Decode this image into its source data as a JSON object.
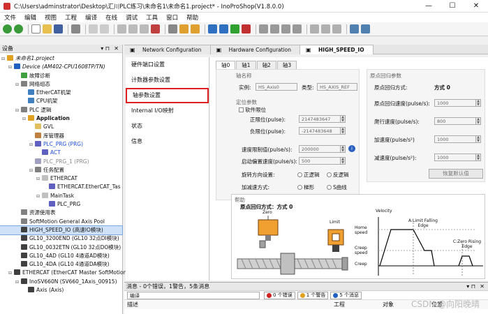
{
  "window": {
    "title": "C:\\Users\\adminstrator\\Desktop\\汇川PLC练习\\未命名1\\未命名1.project* - InoProShop(V1.8.0.0)"
  },
  "menu": [
    "文件",
    "编辑",
    "视图",
    "工程",
    "编译",
    "在线",
    "调试",
    "工具",
    "窗口",
    "帮助"
  ],
  "devices_pane": {
    "title": "设备",
    "tree": [
      {
        "label": "未命名1.project",
        "indent": 0,
        "color": "#e0a020",
        "expand": "▬",
        "italic": true
      },
      {
        "label": "Device (AM402-CPU1608TP/TN)",
        "indent": 1,
        "color": "#2060c0",
        "expand": "▬",
        "italic": true
      },
      {
        "label": "故障诊断",
        "indent": 2,
        "color": "#40a040",
        "expand": ""
      },
      {
        "label": "网络组态",
        "indent": 2,
        "color": "#808080",
        "expand": "▬"
      },
      {
        "label": "EtherCAT机架",
        "indent": 3,
        "color": "#4080c0",
        "expand": ""
      },
      {
        "label": "CPU机架",
        "indent": 3,
        "color": "#4080c0",
        "expand": ""
      },
      {
        "label": "PLC 逻辑",
        "indent": 2,
        "color": "#808080",
        "expand": "▬"
      },
      {
        "label": "Application",
        "indent": 3,
        "color": "#e0a020",
        "expand": "▬",
        "bold": true
      },
      {
        "label": "GVL",
        "indent": 4,
        "color": "#e0c060",
        "expand": ""
      },
      {
        "label": "库管理器",
        "indent": 4,
        "color": "#c08040",
        "expand": ""
      },
      {
        "label": "PLC_PRG (PRG)",
        "indent": 4,
        "color": "#6060c0",
        "expand": "▬",
        "cls": "blue"
      },
      {
        "label": "ACT",
        "indent": 5,
        "color": "#6060c0",
        "expand": "",
        "cls": "blue"
      },
      {
        "label": "PLC_PRG_1 (PRG)",
        "indent": 4,
        "color": "#a0a0c0",
        "expand": "",
        "cls": "gray"
      },
      {
        "label": "任务配置",
        "indent": 4,
        "color": "#808080",
        "expand": "▬"
      },
      {
        "label": "ETHERCAT",
        "indent": 5,
        "color": "#c0c0c0",
        "expand": "▬"
      },
      {
        "label": "ETHERCAT.EtherCAT_Tas",
        "indent": 6,
        "color": "#6060c0",
        "expand": ""
      },
      {
        "label": "MainTask",
        "indent": 5,
        "color": "#c0c0c0",
        "expand": "▬"
      },
      {
        "label": "PLC_PRG",
        "indent": 6,
        "color": "#6060c0",
        "expand": ""
      },
      {
        "label": "资源使用表",
        "indent": 2,
        "color": "#808080",
        "expand": ""
      },
      {
        "label": "SoftMotion General Axis Pool",
        "indent": 2,
        "color": "#808080",
        "expand": ""
      },
      {
        "label": "HIGH_SPEED_IO (高速IO模块)",
        "indent": 2,
        "color": "#404040",
        "expand": "",
        "selected": true
      },
      {
        "label": "GL10_3200END (GL10 32点DI模块)",
        "indent": 2,
        "color": "#404040",
        "expand": ""
      },
      {
        "label": "GL10_0032ETN (GL10 32点DO模块)",
        "indent": 2,
        "color": "#404040",
        "expand": ""
      },
      {
        "label": "GL10_4AD (GL10 4通道AD模块)",
        "indent": 2,
        "color": "#404040",
        "expand": ""
      },
      {
        "label": "GL10_4DA (GL10 4通道DA模块)",
        "indent": 2,
        "color": "#404040",
        "expand": ""
      },
      {
        "label": "ETHERCAT (EtherCAT Master SoftMotion)",
        "indent": 1,
        "color": "#404040",
        "expand": "▬"
      },
      {
        "label": "InoSV660N (SV660_1Axis_00915)",
        "indent": 2,
        "color": "#404040",
        "expand": "▬"
      },
      {
        "label": "Axis (Axis)",
        "indent": 3,
        "color": "#404040",
        "expand": ""
      }
    ]
  },
  "editor_tabs": [
    {
      "label": "Network Configuration",
      "active": false
    },
    {
      "label": "Hardware Configuration",
      "active": false
    },
    {
      "label": "HIGH_SPEED_IO",
      "active": true
    }
  ],
  "side_menu": [
    "硬件端口设置",
    "计数器参数设置",
    "轴参数设置",
    "Internal I/O映射",
    "状态",
    "信息"
  ],
  "axis_tabs": [
    "轴0",
    "轴1",
    "轴2",
    "轴3"
  ],
  "axis_name": {
    "group": "轴名称",
    "instance_label": "实例:",
    "instance_value": "HS_Axis0",
    "type_label": "类型:",
    "type_value": "HS_AXIS_REF"
  },
  "positioning": {
    "group": "定位参数",
    "soft_limit_label": "软件限位",
    "pos_limit_label": "正限位(pulse):",
    "pos_limit_value": "2147483647",
    "neg_limit_label": "负限位(pulse):",
    "neg_limit_value": "-2147483648",
    "speed_limit_label": "速度限制值(pulse/s):",
    "speed_limit_value": "200000",
    "start_offset_label": "启动偏置速度(pulse/s):",
    "start_offset_value": "500",
    "rotation_label": "旋转方向设置:",
    "rot_pos": "正逻辑",
    "rot_neg": "反逻辑",
    "accel_label": "加减速方式:",
    "accel_trap": "梯形",
    "accel_s": "S曲线"
  },
  "homing": {
    "group": "原点回归参数",
    "mode_label": "原点回归方式:",
    "mode_value": "方式 0",
    "home_speed_label": "原点回归速度(pulse/s):",
    "home_speed_value": "1000",
    "creep_speed_label": "爬行速度(pulse/s):",
    "creep_speed_value": "800",
    "acc_label": "加速度(pulse/s²)",
    "acc_value": "1000",
    "dec_label": "减速度(pulse/s²):",
    "dec_value": "1000",
    "reset_button": "恢复默认值"
  },
  "help": {
    "group": "帮助",
    "title": "原点回归方式：方式 0",
    "zero": "Zero",
    "limit": "Limit",
    "velocity": "Velocity",
    "home_speed": "Home speed",
    "creep_speed": "Creep speed",
    "creep": "Creep",
    "a_label": "A:Limit Falling Edge",
    "c_label": "C:Zero Rising Edge"
  },
  "messages": {
    "title": "消息 - 0个错误，1警告，5条消息",
    "source": "编译",
    "errors": "0 个错误",
    "warnings": "1 个警告",
    "infos": "5 个消息",
    "columns": [
      "描述",
      "工程",
      "对象",
      "位置"
    ]
  },
  "watermark": "CSDN @向阳晚晴"
}
